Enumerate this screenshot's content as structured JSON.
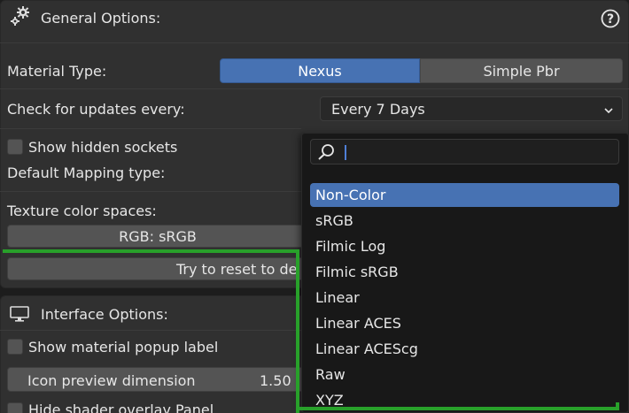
{
  "general": {
    "title": "General Options:",
    "material_type_label": "Material Type:",
    "material_options": [
      "Nexus",
      "Simple Pbr"
    ],
    "updates_label": "Check for updates every:",
    "updates_value": "Every 7 Days",
    "show_hidden_sockets_label": "Show hidden sockets",
    "default_mapping_label": "Default Mapping type:",
    "texture_color_spaces_label": "Texture color spaces:",
    "rgb_button": "RGB: sRGB",
    "reset_button": "Try to reset to de"
  },
  "interface": {
    "title": "Interface Options:",
    "show_popup_label": "Show material popup label",
    "icon_preview_label": "Icon preview dimension",
    "icon_preview_value": "1.50",
    "hide_overlay_label": "Hide shader overlay Panel"
  },
  "colorspace_menu": {
    "search_value": "",
    "items": [
      "Non-Color",
      "sRGB",
      "Filmic Log",
      "Filmic sRGB",
      "Linear",
      "Linear ACES",
      "Linear ACEScg",
      "Raw",
      "XYZ"
    ],
    "selected": "Non-Color"
  },
  "icons": {
    "gear": "gear-icon",
    "help": "help-icon",
    "chevron": "chevron-down-icon",
    "search": "search-icon",
    "monitor": "monitor-icon"
  },
  "colors": {
    "accent": "#4772b3",
    "annotation": "#28a02a",
    "background": "#303030"
  }
}
